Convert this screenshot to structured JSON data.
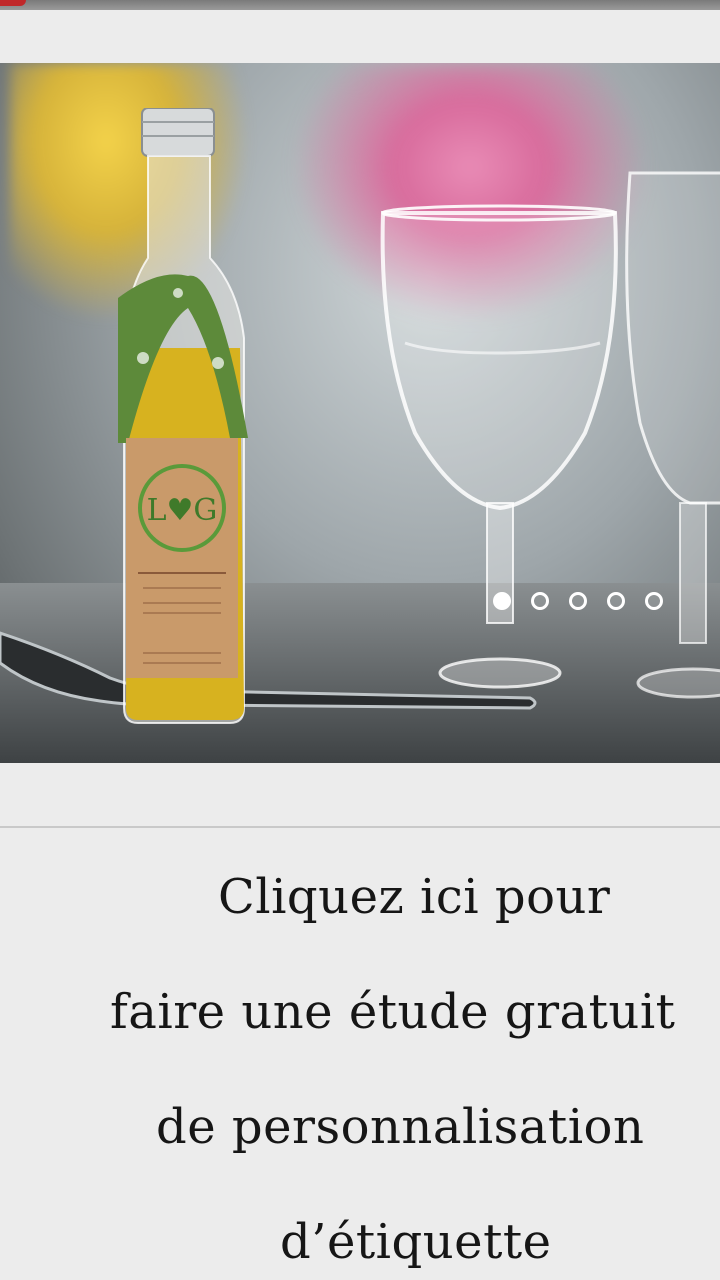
{
  "cta": {
    "lines": [
      "Cliquez ici pour",
      "faire une étude gratuit",
      "de personnalisation",
      "d’étiquette"
    ]
  },
  "slider": {
    "dot_count": 5,
    "active_index": 0,
    "label_monogram": "L♥G"
  },
  "colors": {
    "background": "#ececec",
    "top_accent": "#c0282a",
    "label_green": "#5a9a3a"
  }
}
